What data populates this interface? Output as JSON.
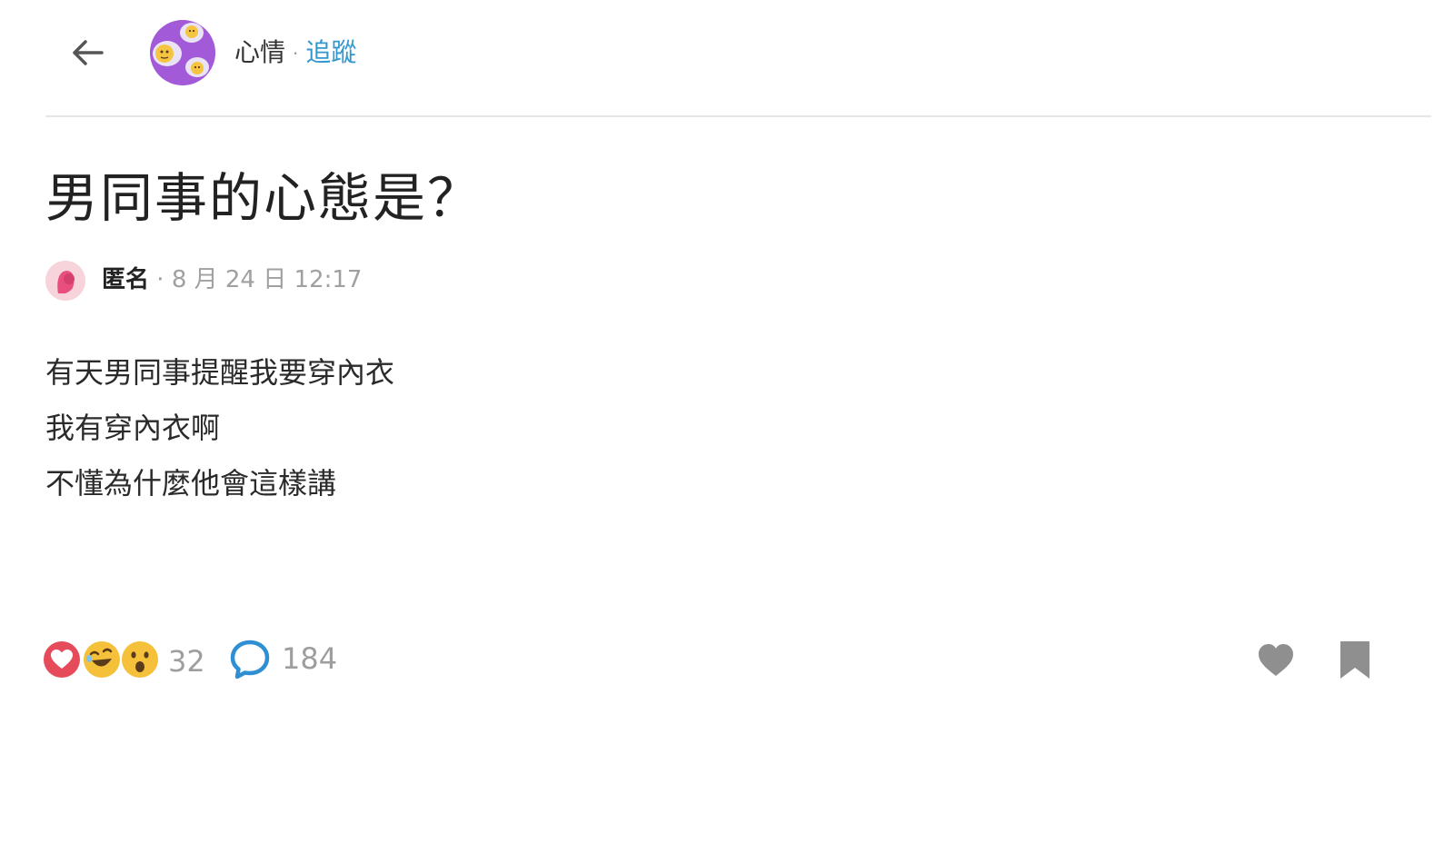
{
  "header": {
    "forum_name": "心情",
    "separator": "·",
    "follow_label": "追蹤"
  },
  "post": {
    "title": "男同事的心態是？",
    "author": "匿名",
    "separator": "·",
    "timestamp": "8 月 24 日 12:17",
    "body_lines": [
      "有天男同事提醒我要穿內衣",
      "我有穿內衣啊",
      "不懂為什麼他會這樣講"
    ]
  },
  "footer": {
    "reaction_icons": [
      "heart-reaction-icon",
      "laughing-reaction-icon",
      "surprised-reaction-icon"
    ],
    "reaction_count": "32",
    "comment_count": "184"
  },
  "colors": {
    "accent": "#3397cf",
    "forum_avatar_bg": "#a35ad8",
    "heart_red": "#e64b5b",
    "muted_text": "#9e9e9e",
    "icon_gray": "#8f8f8f"
  }
}
